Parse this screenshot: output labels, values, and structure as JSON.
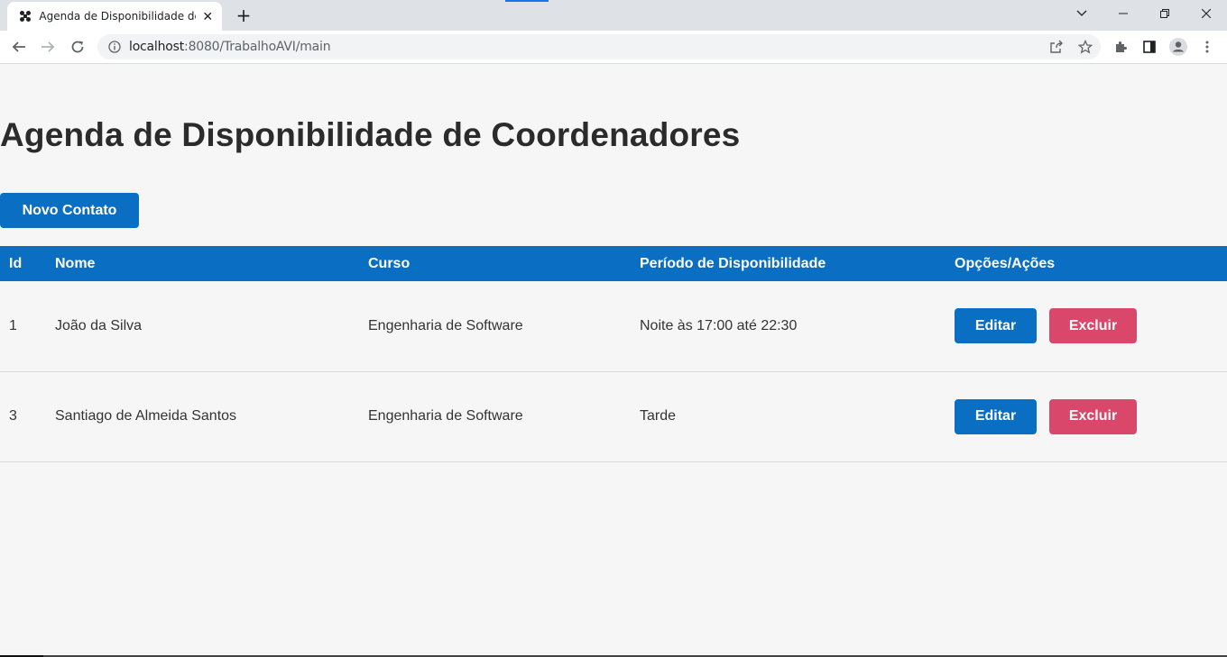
{
  "browser": {
    "tab_title": "Agenda de Disponibilidade de Coordenadores",
    "tab_close": "✕",
    "new_tab": "+",
    "url_host": "localhost",
    "url_rest": ":8080/TrabalhoAVI/main"
  },
  "page": {
    "title": "Agenda de Disponibilidade de Coordenadores",
    "new_contact_label": "Novo Contato"
  },
  "table": {
    "headers": {
      "id": "Id",
      "nome": "Nome",
      "curso": "Curso",
      "periodo": "Período de Disponibilidade",
      "acoes": "Opções/Ações"
    },
    "rows": [
      {
        "id": "1",
        "nome": "João da Silva",
        "curso": "Engenharia de Software",
        "periodo": "Noite às 17:00 até 22:30",
        "edit": "Editar",
        "delete": "Excluir"
      },
      {
        "id": "3",
        "nome": "Santiago de Almeida Santos",
        "curso": "Engenharia de Software",
        "periodo": "Tarde",
        "edit": "Editar",
        "delete": "Excluir"
      }
    ]
  },
  "colors": {
    "primary": "#0a6fc2",
    "danger": "#d9486b",
    "background": "#f6f6f6"
  }
}
